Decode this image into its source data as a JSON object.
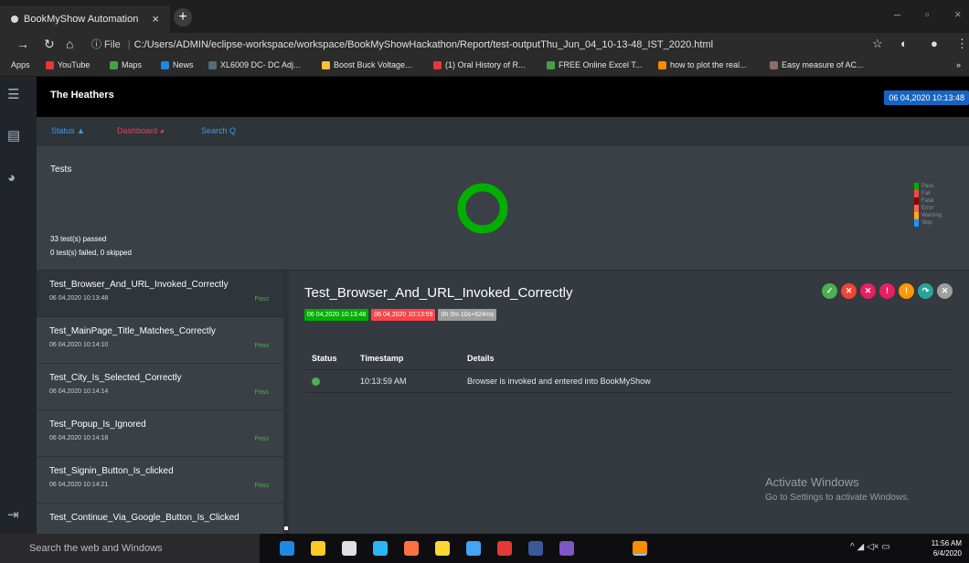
{
  "browser": {
    "tab_title": "BookMyShow Automation",
    "tab_close": "×",
    "new_tab": "+",
    "window_controls": {
      "minimize": "–",
      "restore": "▫",
      "close": "×"
    },
    "url_prefix": "ⓘ File",
    "url": "C:/Users/ADMIN/eclipse-workspace/workspace/BookMyShowHackathon/Report/test-outputThu_Jun_04_10-13-48_IST_2020.html",
    "bookmarks": [
      {
        "label": "Apps",
        "color": ""
      },
      {
        "label": "YouTube",
        "color": "#e53935"
      },
      {
        "label": "Maps",
        "color": "#43a047"
      },
      {
        "label": "News",
        "color": "#1e88e5"
      },
      {
        "label": "XL6009 DC- DC Adj...",
        "color": "#546e7a"
      },
      {
        "label": "Boost Buck Voltage...",
        "color": "#fbc02d"
      },
      {
        "label": "(1) Oral History of R...",
        "color": "#e53935"
      },
      {
        "label": "FREE Online Excel T...",
        "color": "#43a047"
      },
      {
        "label": "how to plot the real...",
        "color": "#fb8c00"
      },
      {
        "label": "Easy measure of AC...",
        "color": "#8d6e63"
      }
    ],
    "bookmarks_more": "»"
  },
  "report": {
    "brand": "The Heathers",
    "date_badge": "06 04,2020 10:13:48",
    "nav": {
      "status": "Status ▲",
      "dashboard": "Dashboard ◕",
      "search": "Search Q"
    },
    "summary": {
      "title": "Tests",
      "passed_text": "33 test(s) passed",
      "failed_text": "0 test(s) failed, 0 skipped",
      "legend": [
        {
          "label": "Pass",
          "color": "#00af00"
        },
        {
          "label": "Fail",
          "color": "#f7464a"
        },
        {
          "label": "Fatal",
          "color": "#8b0000"
        },
        {
          "label": "Error",
          "color": "#ff6347"
        },
        {
          "label": "Warning",
          "color": "#ffa81c"
        },
        {
          "label": "Skip",
          "color": "#1e90ff"
        }
      ],
      "pass_fraction": 1.0
    },
    "tests": [
      {
        "name": "Test_Browser_And_URL_Invoked_Correctly",
        "time": "06 04,2020 10:13:48",
        "status": "Pass"
      },
      {
        "name": "Test_MainPage_Title_Matches_Correctly",
        "time": "06 04,2020 10:14:10",
        "status": "Pass"
      },
      {
        "name": "Test_City_Is_Selected_Correctly",
        "time": "06 04,2020 10:14:14",
        "status": "Pass"
      },
      {
        "name": "Test_Popup_Is_Ignored",
        "time": "06 04,2020 10:14:18",
        "status": "Pass"
      },
      {
        "name": "Test_Signin_Button_Is_clicked",
        "time": "06 04,2020 10:14:21",
        "status": "Pass"
      },
      {
        "name": "Test_Continue_Via_Google_Button_Is_Clicked",
        "time": "",
        "status": ""
      }
    ],
    "detail": {
      "title": "Test_Browser_And_URL_Invoked_Correctly",
      "start": "06 04,2020 10:13:48",
      "end": "06 04,2020 10:13:59",
      "duration": "0h 0m 10s+624ms",
      "columns": {
        "status": "Status",
        "timestamp": "Timestamp",
        "details": "Details"
      },
      "rows": [
        {
          "timestamp": "10:13:59 AM",
          "details": "Browser is invoked and entered into BookMyShow"
        }
      ],
      "filter_buttons": [
        {
          "symbol": "✓",
          "color": "#4caf50"
        },
        {
          "symbol": "✕",
          "color": "#f44336"
        },
        {
          "symbol": "✕",
          "color": "#e91e63"
        },
        {
          "symbol": "!",
          "color": "#e91e63"
        },
        {
          "symbol": "!",
          "color": "#ff9800"
        },
        {
          "symbol": "↷",
          "color": "#26a69a"
        },
        {
          "symbol": "✕",
          "color": "#9e9e9e"
        }
      ]
    }
  },
  "watermark": {
    "line1": "Activate Windows",
    "line2": "Go to Settings to activate Windows."
  },
  "taskbar": {
    "search_placeholder": "Search the web and Windows",
    "time": "11:56 AM",
    "date": "6/4/2020",
    "tray_icons": "^ ◢ ◁× ▭"
  }
}
